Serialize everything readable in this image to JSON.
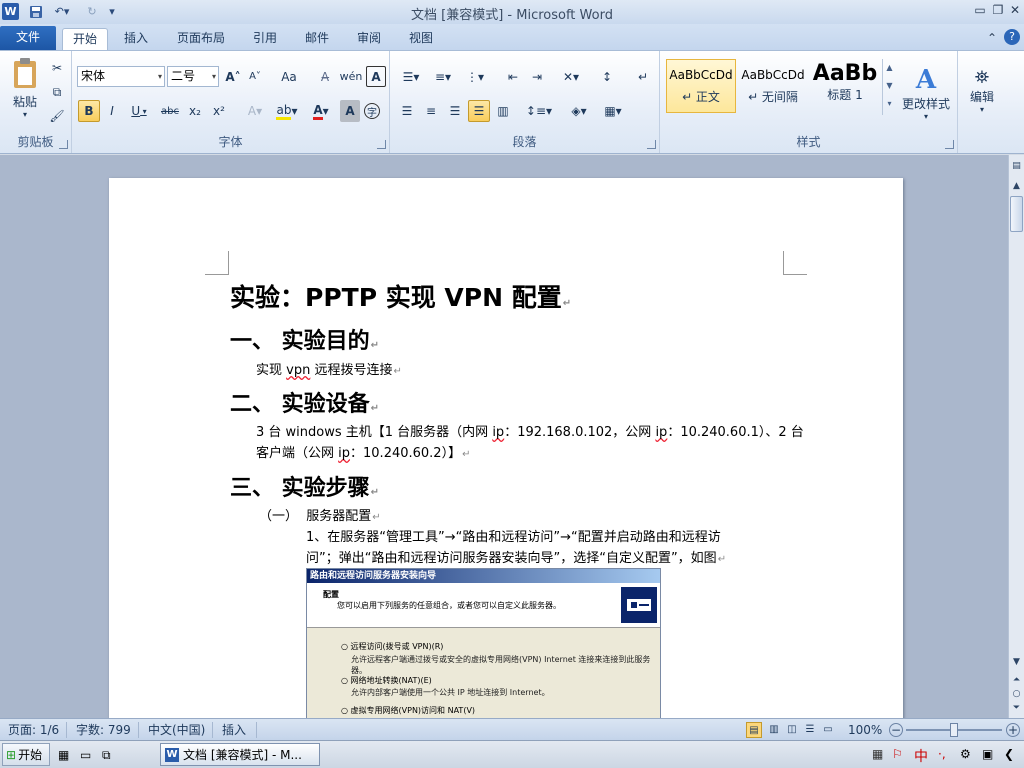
{
  "window": {
    "title": "文档 [兼容模式] - Microsoft Word",
    "app_icon": "W"
  },
  "tabs": [
    {
      "label": "文件",
      "kind": "file"
    },
    {
      "label": "开始",
      "kind": "active"
    },
    {
      "label": "插入"
    },
    {
      "label": "页面布局"
    },
    {
      "label": "引用"
    },
    {
      "label": "邮件"
    },
    {
      "label": "审阅"
    },
    {
      "label": "视图"
    }
  ],
  "ribbon": {
    "clipboard": {
      "label": "剪贴板",
      "paste": "粘贴"
    },
    "font": {
      "label": "字体",
      "font_name": "宋体",
      "font_size": "二号",
      "bold": "B",
      "italic": "I",
      "underline": "U",
      "strike": "abc",
      "subscript": "x₂",
      "superscript": "x²",
      "grow": "A˄",
      "shrink": "A˅",
      "change_case": "Aa",
      "clear": "A"
    },
    "paragraph": {
      "label": "段落"
    },
    "styles": {
      "label": "样式",
      "items": [
        {
          "preview": "AaBbCcDd",
          "name": "↵ 正文"
        },
        {
          "preview": "AaBbCcDd",
          "name": "↵ 无间隔"
        },
        {
          "preview": "AaBb",
          "name": "标题 1"
        }
      ],
      "change_styles": "更改样式"
    },
    "editing": {
      "label": "编辑"
    }
  },
  "document": {
    "title": "实验：PPTP 实现 VPN 配置",
    "h1": "一、 实验目的",
    "p1": {
      "a": "实现 ",
      "b": "vpn",
      "c": " 远程拨号连接"
    },
    "h2": "二、 实验设备",
    "p2_line1": {
      "a": "3 台 windows 主机【1 台服务器（内网 ",
      "b": "ip",
      "c": "：192.168.0.102，公网 ",
      "d": "ip",
      "e": "：10.240.60.1）、2 台"
    },
    "p2_line2": {
      "a": "客户端（公网 ",
      "b": "ip",
      "c": "：10.240.60.2）】"
    },
    "h3": "三、 实验步骤",
    "sub1": "（一）  服务器配置",
    "step1_line1": "1、在服务器“管理工具”→“路由和远程访问”→“配置并启动路由和远程访",
    "step1_line2": "问”；弹出“路由和远程访问服务器安装向导”，选择“自定义配置”，如图",
    "para_mark": "↵",
    "dialog": {
      "caption": "路由和远程访问服务器安装向导",
      "heading": "配置",
      "subheading": "您可以启用下列服务的任意组合，或者您可以自定义此服务器。",
      "options": [
        {
          "label": "远程访问(拨号或 VPN)(R)",
          "desc": "允许远程客户端通过拨号或安全的虚拟专用网络(VPN) Internet 连接来连接到此服务器。"
        },
        {
          "label": "网络地址转换(NAT)(E)",
          "desc": "允许内部客户端使用一个公共 IP 地址连接到 Internet。"
        },
        {
          "label": "虚拟专用网络(VPN)访问和 NAT(V)",
          "desc": ""
        }
      ]
    }
  },
  "status": {
    "page": "页面: 1/6",
    "words": "字数: 799",
    "language": "中文(中国)",
    "mode": "插入",
    "zoom": "100%"
  },
  "taskbar": {
    "start": "开始",
    "task": "文档 [兼容模式] - M..."
  }
}
